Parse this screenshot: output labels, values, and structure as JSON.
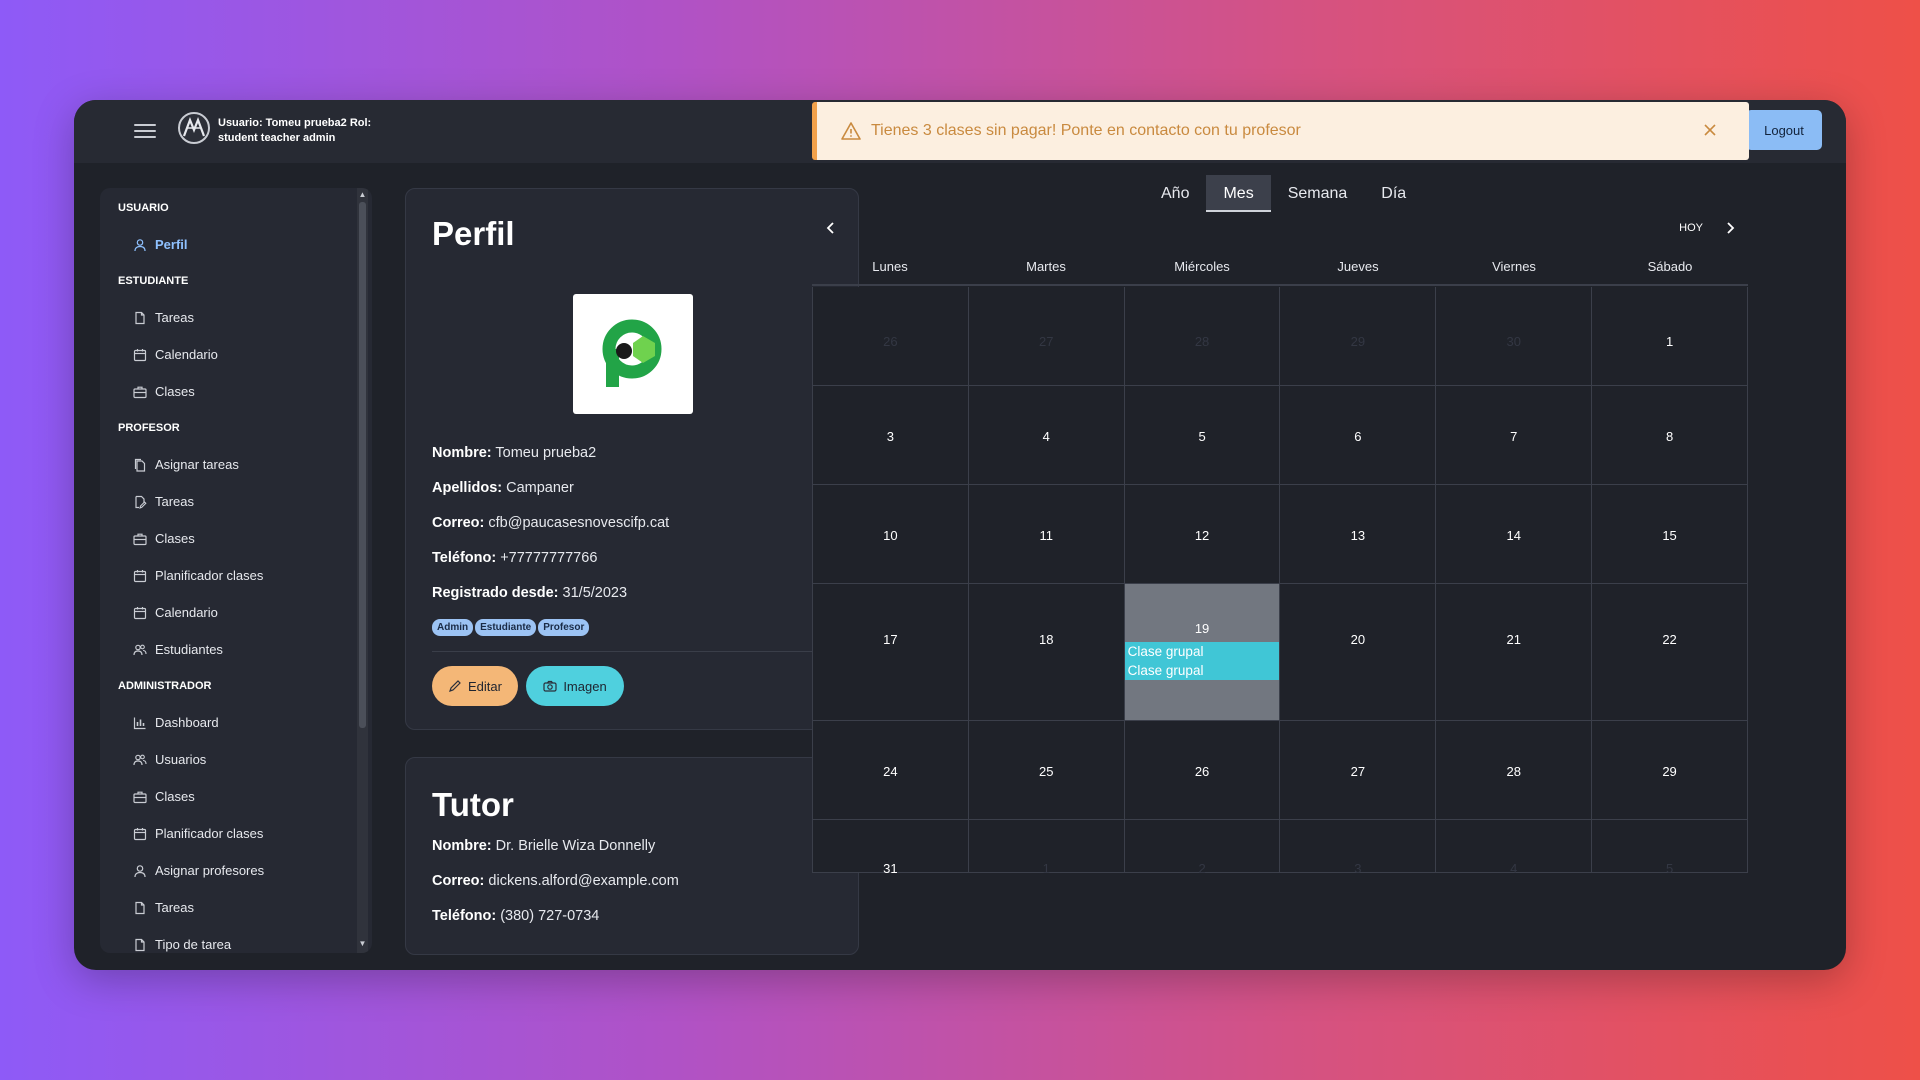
{
  "header": {
    "user_info": "Usuario: Tomeu prueba2 Rol: student teacher admin",
    "logout_label": "Logout"
  },
  "sidebar": {
    "sections": [
      {
        "title": "USUARIO",
        "items": [
          {
            "label": "Perfil",
            "icon": "user-icon",
            "active": true
          }
        ]
      },
      {
        "title": "ESTUDIANTE",
        "items": [
          {
            "label": "Tareas",
            "icon": "file-icon"
          },
          {
            "label": "Calendario",
            "icon": "calendar-icon"
          },
          {
            "label": "Clases",
            "icon": "briefcase-icon"
          }
        ]
      },
      {
        "title": "PROFESOR",
        "items": [
          {
            "label": "Asignar tareas",
            "icon": "file-copy-icon"
          },
          {
            "label": "Tareas",
            "icon": "file-edit-icon"
          },
          {
            "label": "Clases",
            "icon": "briefcase-icon"
          },
          {
            "label": "Planificador clases",
            "icon": "calendar-icon"
          },
          {
            "label": "Calendario",
            "icon": "calendar-icon"
          },
          {
            "label": "Estudiantes",
            "icon": "users-icon"
          }
        ]
      },
      {
        "title": "ADMINISTRADOR",
        "items": [
          {
            "label": "Dashboard",
            "icon": "chart-icon"
          },
          {
            "label": "Usuarios",
            "icon": "users-icon"
          },
          {
            "label": "Clases",
            "icon": "briefcase-icon"
          },
          {
            "label": "Planificador clases",
            "icon": "calendar-icon"
          },
          {
            "label": "Asignar profesores",
            "icon": "user-icon"
          },
          {
            "label": "Tareas",
            "icon": "file-icon"
          },
          {
            "label": "Tipo de tarea",
            "icon": "file-icon"
          }
        ]
      }
    ]
  },
  "profile": {
    "title": "Perfil",
    "fields": [
      {
        "label": "Nombre:",
        "value": "Tomeu prueba2"
      },
      {
        "label": "Apellidos:",
        "value": "Campaner"
      },
      {
        "label": "Correo:",
        "value": "cfb@paucasesnovescifp.cat"
      },
      {
        "label": "Teléfono:",
        "value": "+77777777766"
      },
      {
        "label": "Registrado desde:",
        "value": "31/5/2023"
      }
    ],
    "badges": [
      "Admin",
      "Estudiante",
      "Profesor"
    ],
    "edit_label": "Editar",
    "image_label": "Imagen"
  },
  "tutor": {
    "title": "Tutor",
    "fields": [
      {
        "label": "Nombre:",
        "value": "Dr. Brielle Wiza Donnelly"
      },
      {
        "label": "Correo:",
        "value": "dickens.alford@example.com"
      },
      {
        "label": "Teléfono:",
        "value": "(380) 727-0734"
      }
    ]
  },
  "alert": {
    "text": "Tienes 3 clases sin pagar! Ponte en contacto con tu profesor",
    "color": "#f2a14a"
  },
  "calendar": {
    "views": [
      "Año",
      "Mes",
      "Semana",
      "Día"
    ],
    "active_view": "Mes",
    "today_label": "HOY",
    "weekdays": [
      "Lunes",
      "Martes",
      "Miércoles",
      "Jueves",
      "Viernes",
      "Sábado"
    ],
    "weeks": [
      {
        "days": [
          {
            "n": "26",
            "muted": true
          },
          {
            "n": "27",
            "muted": true
          },
          {
            "n": "28",
            "muted": true
          },
          {
            "n": "29",
            "muted": true
          },
          {
            "n": "30",
            "muted": true
          },
          {
            "n": "1"
          }
        ]
      },
      {
        "days": [
          {
            "n": "3"
          },
          {
            "n": "4"
          },
          {
            "n": "5"
          },
          {
            "n": "6"
          },
          {
            "n": "7"
          },
          {
            "n": "8"
          }
        ]
      },
      {
        "days": [
          {
            "n": "10"
          },
          {
            "n": "11"
          },
          {
            "n": "12"
          },
          {
            "n": "13"
          },
          {
            "n": "14"
          },
          {
            "n": "15"
          }
        ]
      },
      {
        "days": [
          {
            "n": "17"
          },
          {
            "n": "18"
          },
          {
            "n": "19",
            "highlight": true,
            "events": [
              "Clase grupal",
              "Clase grupal"
            ]
          },
          {
            "n": "20"
          },
          {
            "n": "21"
          },
          {
            "n": "22"
          }
        ]
      },
      {
        "days": [
          {
            "n": "24"
          },
          {
            "n": "25"
          },
          {
            "n": "26"
          },
          {
            "n": "27"
          },
          {
            "n": "28"
          },
          {
            "n": "29"
          }
        ]
      },
      {
        "days": [
          {
            "n": "31"
          },
          {
            "n": "1",
            "muted": true
          },
          {
            "n": "2",
            "muted": true
          },
          {
            "n": "3",
            "muted": true
          },
          {
            "n": "4",
            "muted": true
          },
          {
            "n": "5",
            "muted": true
          }
        ]
      }
    ],
    "event_color": "#40c6d6",
    "highlight_color": "#727780"
  }
}
